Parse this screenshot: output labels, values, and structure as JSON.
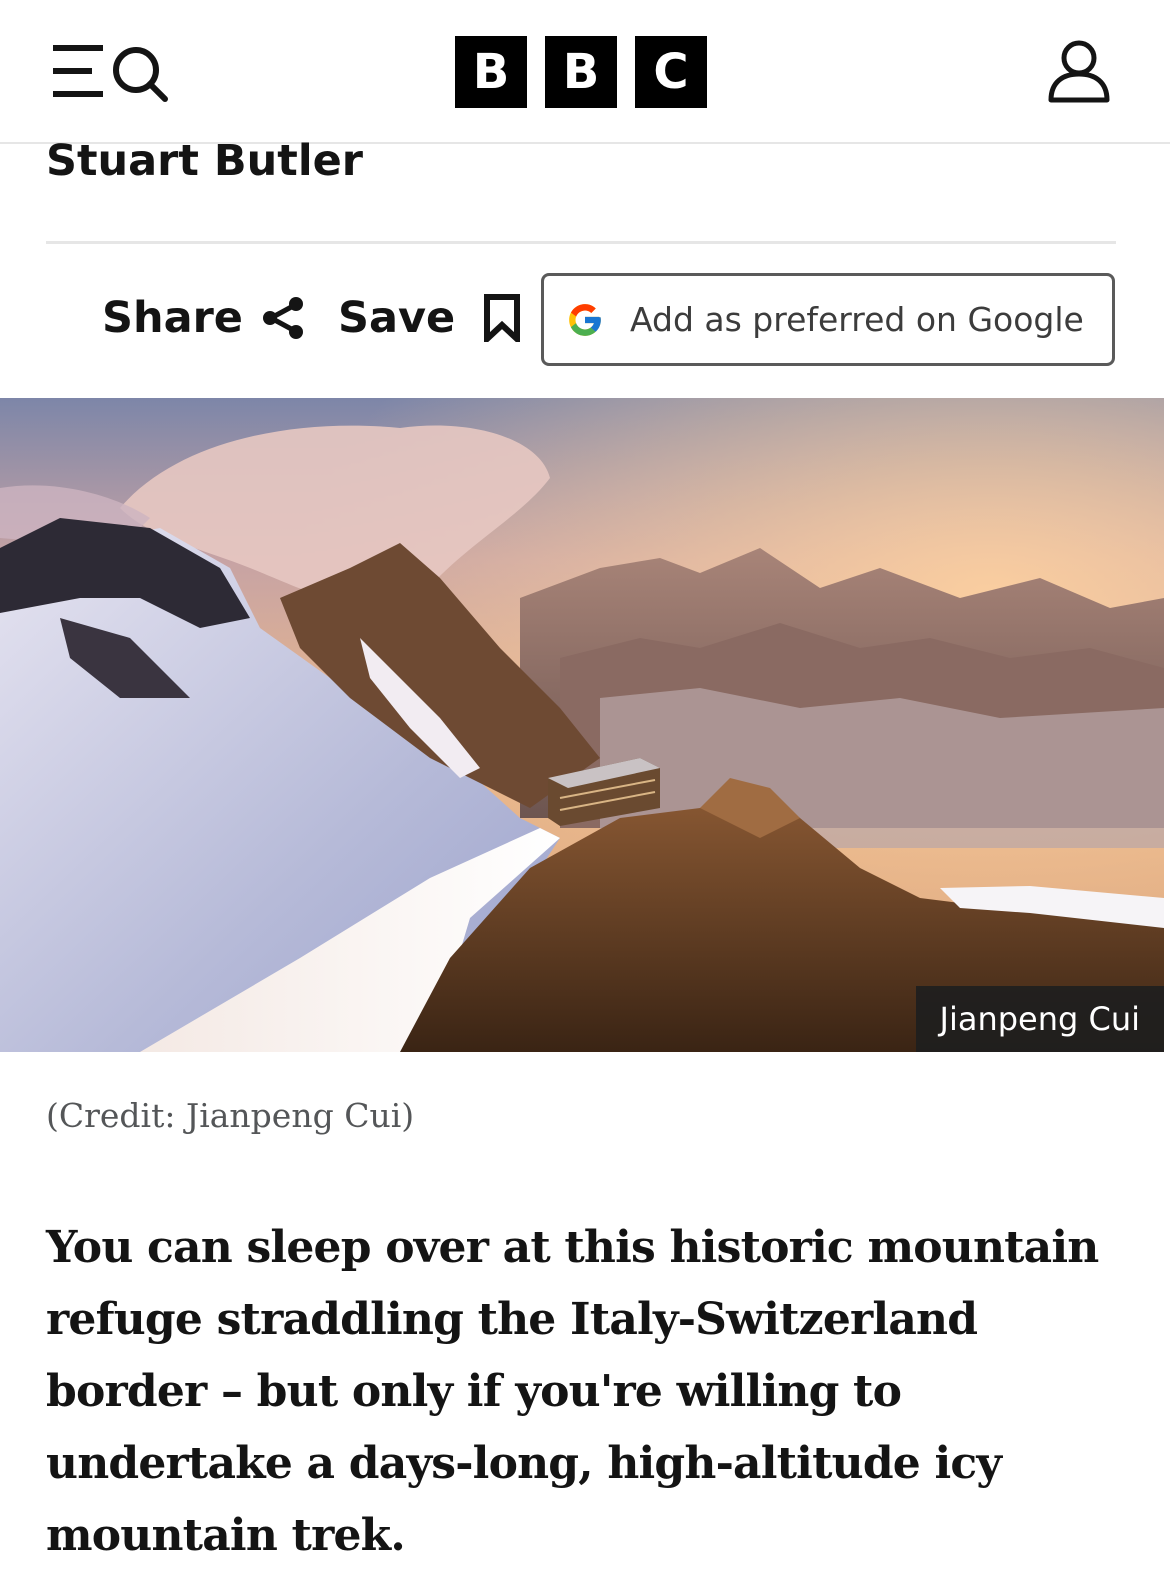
{
  "header": {
    "menu_icon": "menu-icon",
    "search_icon": "search-icon",
    "logo_letters": [
      "B",
      "B",
      "C"
    ],
    "account_icon": "account-icon"
  },
  "article": {
    "author": "Stuart Butler",
    "actions": {
      "share_label": "Share",
      "share_icon": "share-icon",
      "save_label": "Save",
      "save_icon": "bookmark-icon",
      "google_label": "Add as preferred on Google",
      "google_icon": "google-g-icon"
    },
    "image": {
      "credit_overlay": "Jianpeng Cui",
      "caption": "(Credit: Jianpeng Cui)"
    },
    "lead": "You can sleep over at this historic mountain refuge straddling the Italy-Switzerland border – but only if you're willing to undertake a days-long, high-altitude icy mountain trek."
  },
  "colors": {
    "text": "#141414",
    "divider": "#e6e6e6",
    "caption": "#545658",
    "button_border": "#5a5a5a"
  }
}
